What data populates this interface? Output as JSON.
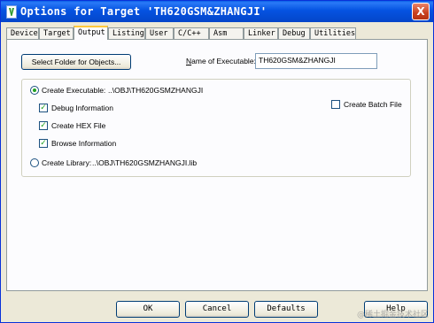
{
  "window": {
    "title": "Options for Target 'TH620GSM&ZHANGJI'",
    "close_glyph": "X"
  },
  "tabs": [
    "Device",
    "Target",
    "Output",
    "Listing",
    "User",
    "C/C++",
    "Asm",
    "Linker",
    "Debug",
    "Utilities"
  ],
  "active_tab": "Output",
  "output": {
    "select_folder_label": "Select Folder for Objects...",
    "name_of_executable_label": "Name of Executable:",
    "name_of_executable_value": "TH620GSM&ZHANGJI",
    "create_executable_label": "Create Executable:",
    "create_executable_path": "..\\OBJ\\TH620GSMZHANGJI",
    "create_executable_selected": true,
    "debug_information_label": "Debug Information",
    "debug_information_checked": true,
    "create_hex_label": "Create HEX File",
    "create_hex_checked": true,
    "browse_information_label": "Browse Information",
    "browse_information_checked": true,
    "create_batch_label": "Create Batch File",
    "create_batch_checked": false,
    "create_library_label": "Create Library:",
    "create_library_path": "..\\OBJ\\TH620GSMZHANGJI.lib",
    "create_library_selected": false,
    "check_glyph": "✓"
  },
  "buttons": {
    "ok": "OK",
    "cancel": "Cancel",
    "defaults": "Defaults",
    "help": "Help"
  },
  "watermark": "@稀土掘金技术社区",
  "colors": {
    "titlebar": "#0553e1",
    "dialog_bg": "#ece9d8",
    "panel_bg": "#fcfcfe",
    "check_green": "#21a121",
    "active_tab_accent": "#ffc83c"
  }
}
